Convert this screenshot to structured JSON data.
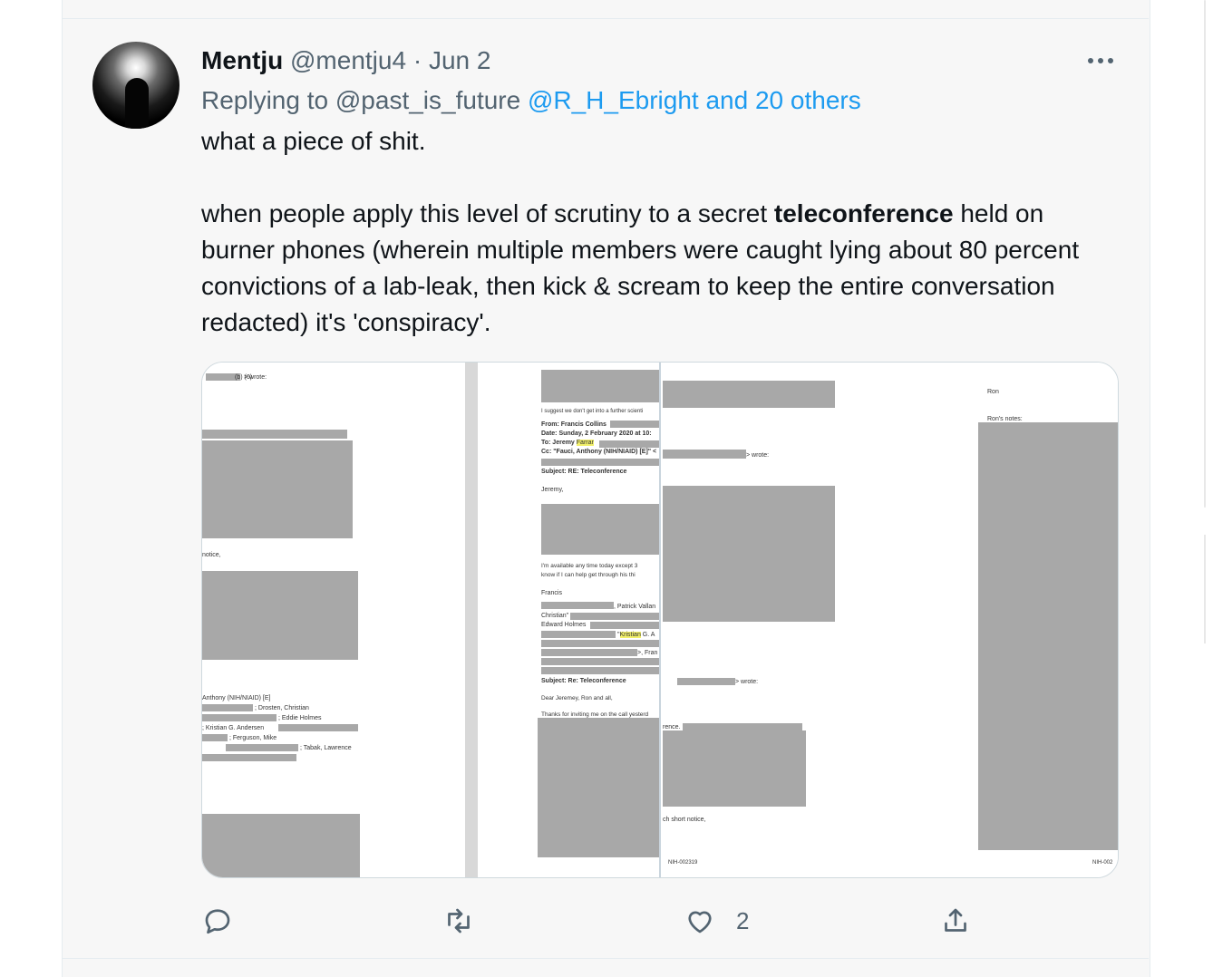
{
  "tweet": {
    "display_name": "Mentju",
    "handle": "@mentju4",
    "separator": "·",
    "date": "Jun 2",
    "replying_prefix": "Replying to",
    "reply_to_first": "@past_is_future",
    "reply_to_others": "@R_H_Ebright and 20 others",
    "body_line1": "what a piece of shit.",
    "body_p2_before": "when people apply this level of scrutiny to a secret ",
    "body_p2_bold": "teleconference",
    "body_p2_after": " held on burner phones (wherein multiple members were caught lying about 80 percent convictions of a lab-leak, then kick & scream to keep the entire conversation redacted) it's 'conspiracy'.",
    "like_count": "2"
  },
  "media": {
    "doc1": {
      "wrote": "> wrote:",
      "notice": "notice,",
      "l1": "Anthony (NIH/NIAID) [E]",
      "l2": "; Drosten, Christian",
      "l3": "; Eddie Holmes",
      "l4": "; Kristian G. Andersen",
      "l5": "; Ferguson, Mike",
      "l6": "; Tabak, Lawrence",
      "code": "(b) (6)"
    },
    "doc2": {
      "suggest": "I suggest we don't get into a further scienti",
      "from": "From: Francis Collins",
      "date": "Date: Sunday, 2 February 2020 at 10:",
      "to_label": "To: Jeremy ",
      "to_hl": "Farrar",
      "cc": "Cc: \"Fauci, Anthony (NIH/NIAID) [E]\" <",
      "subject": "Subject: RE: Teleconference",
      "greet": "Jeremy,",
      "avail1": "I'm available any time today except 3",
      "avail2": "know if I can help get through his thi",
      "sign": "Francis",
      "vallan": ", Patrick Vallan",
      "christian": "Christian\"",
      "holmes": "Edward Holmes",
      "kristian_pre": "\"",
      "kristian_hl": "Kristian",
      "kristian_post": " G. A",
      "fran": ">, Fran",
      "subject2": "Subject: Re: Teleconference",
      "dear": "Dear Jeremey, Ron and all,",
      "thanks": "Thanks for inviting me on the call yesterd"
    },
    "doc3": {
      "wrote": "> wrote:",
      "wrote2": "> wrote:",
      "rence": "rence.",
      "short": "ch short notice,",
      "page": "NIH-002319"
    },
    "doc4": {
      "ron": "Ron",
      "notes": "Ron's notes:",
      "page": "NIH-002"
    }
  },
  "actions": {
    "reply": "reply-icon",
    "retweet": "retweet-icon",
    "like": "heart-icon",
    "share": "share-icon"
  }
}
